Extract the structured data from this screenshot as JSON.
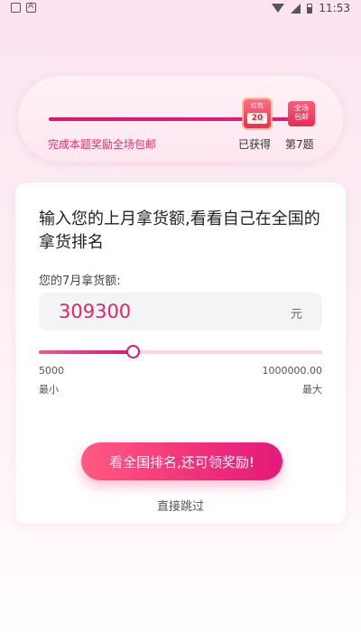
{
  "status_bar": {
    "time": "11:53"
  },
  "progress": {
    "caption": "完成本题奖励全场包邮",
    "reward_redpacket": {
      "top_label": "红包",
      "amount": "20"
    },
    "reward_shipping": {
      "line1": "全场",
      "line2": "包邮"
    },
    "obtained_label": "已获得",
    "next_label": "第7题"
  },
  "question": {
    "title": "输入您的上月拿货额,看看自己在全国的拿货排名",
    "field_label": "您的7月拿货额:",
    "amount_value": "309300",
    "amount_unit": "元"
  },
  "slider": {
    "min_value": "5000",
    "max_value": "1000000.00",
    "min_label": "最小",
    "max_label": "最大",
    "fill_fraction": 0.33
  },
  "actions": {
    "cta_label": "看全国排名,还可领奖励!",
    "skip_label": "直接跳过"
  },
  "colors": {
    "accent": "#e0156f",
    "amount_text": "#e0256a"
  }
}
